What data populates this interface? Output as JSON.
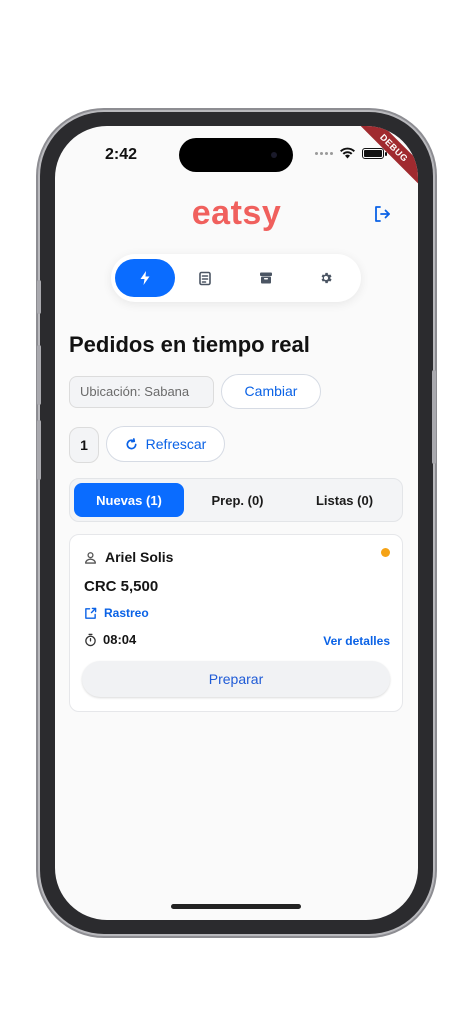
{
  "status_bar": {
    "time": "2:42"
  },
  "debug_label": "DEBUG",
  "header": {
    "logo": "eatsy",
    "logout_icon": "logout-icon"
  },
  "nav": {
    "items": [
      {
        "icon": "bolt-icon",
        "active": true
      },
      {
        "icon": "receipt-icon",
        "active": false
      },
      {
        "icon": "archive-icon",
        "active": false
      },
      {
        "icon": "gear-icon",
        "active": false
      }
    ]
  },
  "page": {
    "title": "Pedidos en tiempo real"
  },
  "location": {
    "label": "Ubicación: Sabana",
    "change_label": "Cambiar"
  },
  "counter": {
    "value": "1"
  },
  "refresh": {
    "label": "Refrescar"
  },
  "tabs": [
    {
      "label": "Nuevas (1)",
      "active": true
    },
    {
      "label": "Prep. (0)",
      "active": false
    },
    {
      "label": "Listas (0)",
      "active": false
    }
  ],
  "order": {
    "customer": "Ariel Solis",
    "price": "CRC 5,500",
    "track_label": "Rastreo",
    "time": "08:04",
    "details_label": "Ver detalles",
    "action_label": "Preparar",
    "status_color": "#f5a316"
  },
  "colors": {
    "accent": "#0a6cff",
    "brand": "#f0605d"
  }
}
